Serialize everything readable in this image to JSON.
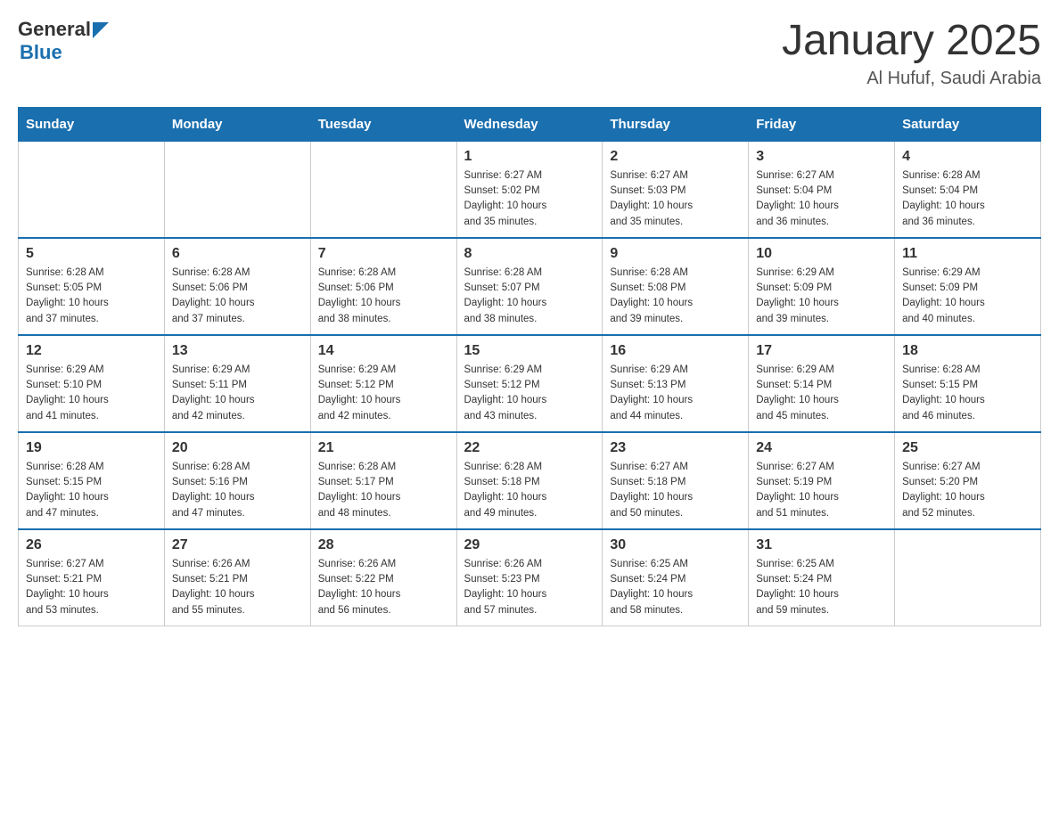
{
  "header": {
    "logo_general": "General",
    "logo_blue": "Blue",
    "month": "January 2025",
    "location": "Al Hufuf, Saudi Arabia"
  },
  "weekdays": [
    "Sunday",
    "Monday",
    "Tuesday",
    "Wednesday",
    "Thursday",
    "Friday",
    "Saturday"
  ],
  "weeks": [
    [
      {
        "day": "",
        "info": ""
      },
      {
        "day": "",
        "info": ""
      },
      {
        "day": "",
        "info": ""
      },
      {
        "day": "1",
        "info": "Sunrise: 6:27 AM\nSunset: 5:02 PM\nDaylight: 10 hours\nand 35 minutes."
      },
      {
        "day": "2",
        "info": "Sunrise: 6:27 AM\nSunset: 5:03 PM\nDaylight: 10 hours\nand 35 minutes."
      },
      {
        "day": "3",
        "info": "Sunrise: 6:27 AM\nSunset: 5:04 PM\nDaylight: 10 hours\nand 36 minutes."
      },
      {
        "day": "4",
        "info": "Sunrise: 6:28 AM\nSunset: 5:04 PM\nDaylight: 10 hours\nand 36 minutes."
      }
    ],
    [
      {
        "day": "5",
        "info": "Sunrise: 6:28 AM\nSunset: 5:05 PM\nDaylight: 10 hours\nand 37 minutes."
      },
      {
        "day": "6",
        "info": "Sunrise: 6:28 AM\nSunset: 5:06 PM\nDaylight: 10 hours\nand 37 minutes."
      },
      {
        "day": "7",
        "info": "Sunrise: 6:28 AM\nSunset: 5:06 PM\nDaylight: 10 hours\nand 38 minutes."
      },
      {
        "day": "8",
        "info": "Sunrise: 6:28 AM\nSunset: 5:07 PM\nDaylight: 10 hours\nand 38 minutes."
      },
      {
        "day": "9",
        "info": "Sunrise: 6:28 AM\nSunset: 5:08 PM\nDaylight: 10 hours\nand 39 minutes."
      },
      {
        "day": "10",
        "info": "Sunrise: 6:29 AM\nSunset: 5:09 PM\nDaylight: 10 hours\nand 39 minutes."
      },
      {
        "day": "11",
        "info": "Sunrise: 6:29 AM\nSunset: 5:09 PM\nDaylight: 10 hours\nand 40 minutes."
      }
    ],
    [
      {
        "day": "12",
        "info": "Sunrise: 6:29 AM\nSunset: 5:10 PM\nDaylight: 10 hours\nand 41 minutes."
      },
      {
        "day": "13",
        "info": "Sunrise: 6:29 AM\nSunset: 5:11 PM\nDaylight: 10 hours\nand 42 minutes."
      },
      {
        "day": "14",
        "info": "Sunrise: 6:29 AM\nSunset: 5:12 PM\nDaylight: 10 hours\nand 42 minutes."
      },
      {
        "day": "15",
        "info": "Sunrise: 6:29 AM\nSunset: 5:12 PM\nDaylight: 10 hours\nand 43 minutes."
      },
      {
        "day": "16",
        "info": "Sunrise: 6:29 AM\nSunset: 5:13 PM\nDaylight: 10 hours\nand 44 minutes."
      },
      {
        "day": "17",
        "info": "Sunrise: 6:29 AM\nSunset: 5:14 PM\nDaylight: 10 hours\nand 45 minutes."
      },
      {
        "day": "18",
        "info": "Sunrise: 6:28 AM\nSunset: 5:15 PM\nDaylight: 10 hours\nand 46 minutes."
      }
    ],
    [
      {
        "day": "19",
        "info": "Sunrise: 6:28 AM\nSunset: 5:15 PM\nDaylight: 10 hours\nand 47 minutes."
      },
      {
        "day": "20",
        "info": "Sunrise: 6:28 AM\nSunset: 5:16 PM\nDaylight: 10 hours\nand 47 minutes."
      },
      {
        "day": "21",
        "info": "Sunrise: 6:28 AM\nSunset: 5:17 PM\nDaylight: 10 hours\nand 48 minutes."
      },
      {
        "day": "22",
        "info": "Sunrise: 6:28 AM\nSunset: 5:18 PM\nDaylight: 10 hours\nand 49 minutes."
      },
      {
        "day": "23",
        "info": "Sunrise: 6:27 AM\nSunset: 5:18 PM\nDaylight: 10 hours\nand 50 minutes."
      },
      {
        "day": "24",
        "info": "Sunrise: 6:27 AM\nSunset: 5:19 PM\nDaylight: 10 hours\nand 51 minutes."
      },
      {
        "day": "25",
        "info": "Sunrise: 6:27 AM\nSunset: 5:20 PM\nDaylight: 10 hours\nand 52 minutes."
      }
    ],
    [
      {
        "day": "26",
        "info": "Sunrise: 6:27 AM\nSunset: 5:21 PM\nDaylight: 10 hours\nand 53 minutes."
      },
      {
        "day": "27",
        "info": "Sunrise: 6:26 AM\nSunset: 5:21 PM\nDaylight: 10 hours\nand 55 minutes."
      },
      {
        "day": "28",
        "info": "Sunrise: 6:26 AM\nSunset: 5:22 PM\nDaylight: 10 hours\nand 56 minutes."
      },
      {
        "day": "29",
        "info": "Sunrise: 6:26 AM\nSunset: 5:23 PM\nDaylight: 10 hours\nand 57 minutes."
      },
      {
        "day": "30",
        "info": "Sunrise: 6:25 AM\nSunset: 5:24 PM\nDaylight: 10 hours\nand 58 minutes."
      },
      {
        "day": "31",
        "info": "Sunrise: 6:25 AM\nSunset: 5:24 PM\nDaylight: 10 hours\nand 59 minutes."
      },
      {
        "day": "",
        "info": ""
      }
    ]
  ]
}
